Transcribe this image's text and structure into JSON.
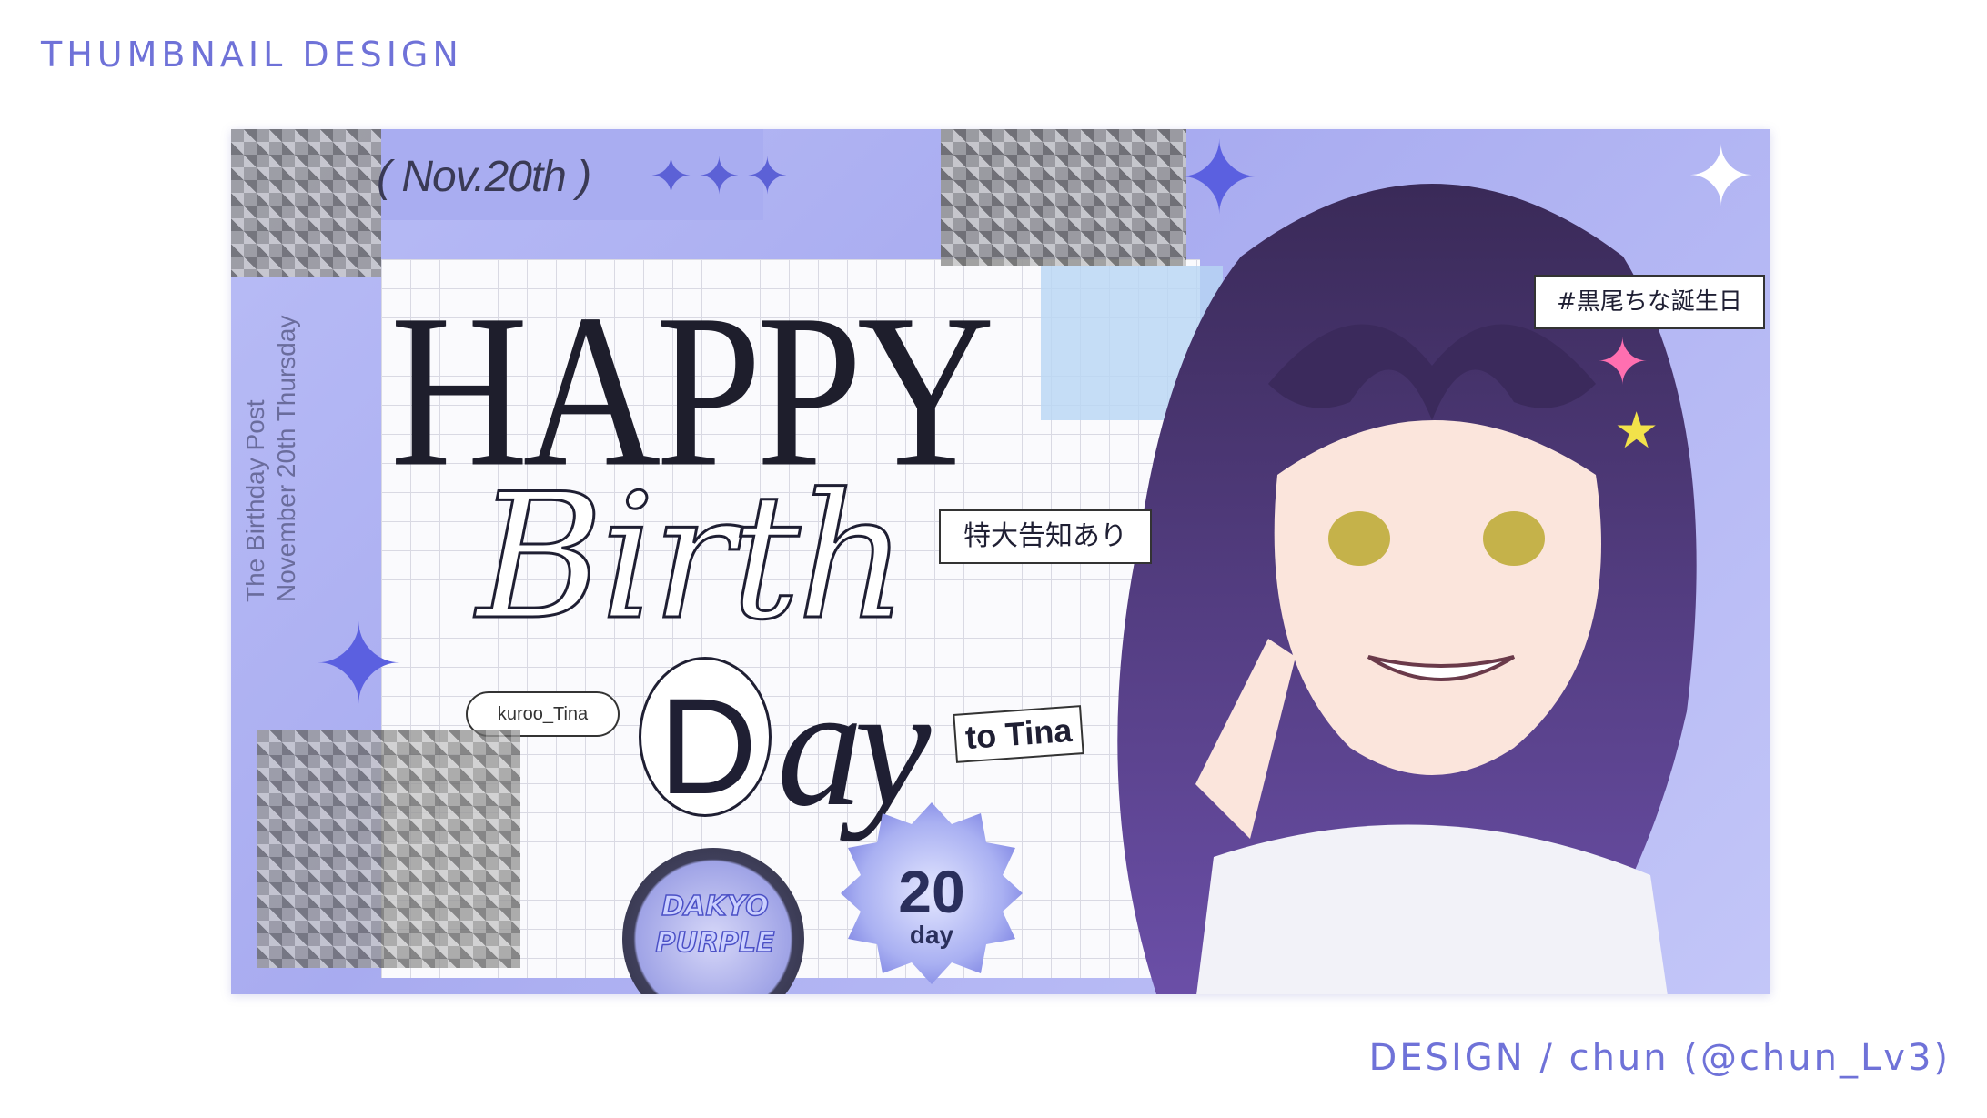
{
  "page_heading": "THUMBNAIL DESIGN",
  "credit": "DESIGN / chun (@chun_Lv3)",
  "thumbnail": {
    "date": "( Nov.20th )",
    "sparkles": "✦✦✦",
    "vertical_text": {
      "line1": "The Birthday Post",
      "line2": "November   20th   Thursday"
    },
    "title_happy": "HAPPY",
    "title_birth": "Birth",
    "title_day_d": "D",
    "title_day_rest": "ay",
    "to_tina": "to Tina",
    "handle": "kuroo_Tina",
    "sticker": {
      "line1": "DAKYO",
      "line2": "PURPLE"
    },
    "badge": {
      "number": "20",
      "unit": "day"
    },
    "notice": "特大告知あり",
    "hashtag": "#黒尾ちな誕生日"
  },
  "colors": {
    "accent": "#6f72d8",
    "panel_lavender": "#a9adf1",
    "ink": "#1e1e2c"
  }
}
